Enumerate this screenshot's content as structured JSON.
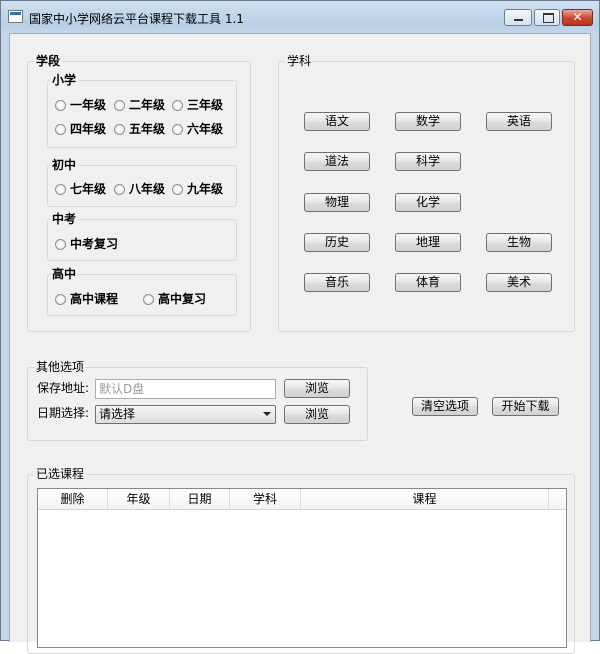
{
  "window": {
    "title": "国家中小学网络云平台课程下载工具 1.1",
    "minimize": "0",
    "maximize": "1",
    "close": "r"
  },
  "stage": {
    "title": "学段",
    "primary": {
      "title": "小学",
      "options": [
        "一年级",
        "二年级",
        "三年级",
        "四年级",
        "五年级",
        "六年级"
      ]
    },
    "junior": {
      "title": "初中",
      "options": [
        "七年级",
        "八年级",
        "九年级"
      ]
    },
    "zhongkao": {
      "title": "中考",
      "options": [
        "中考复习"
      ]
    },
    "senior": {
      "title": "高中",
      "options": [
        "高中课程",
        "高中复习"
      ]
    }
  },
  "subjects": {
    "title": "学科",
    "items": [
      "语文",
      "数学",
      "英语",
      "道法",
      "科学",
      "物理",
      "化学",
      "历史",
      "地理",
      "生物",
      "音乐",
      "体育",
      "美术"
    ]
  },
  "other": {
    "title": "其他选项",
    "save_label": "保存地址:",
    "save_placeholder": "默认D盘",
    "date_label": "日期选择:",
    "date_value": "请选择",
    "browse1": "浏览",
    "browse2": "浏览"
  },
  "actions": {
    "clear": "清空选项",
    "download": "开始下载"
  },
  "selected": {
    "title": "已选课程",
    "columns": [
      "删除",
      "年级",
      "日期",
      "学科",
      "课程"
    ]
  }
}
